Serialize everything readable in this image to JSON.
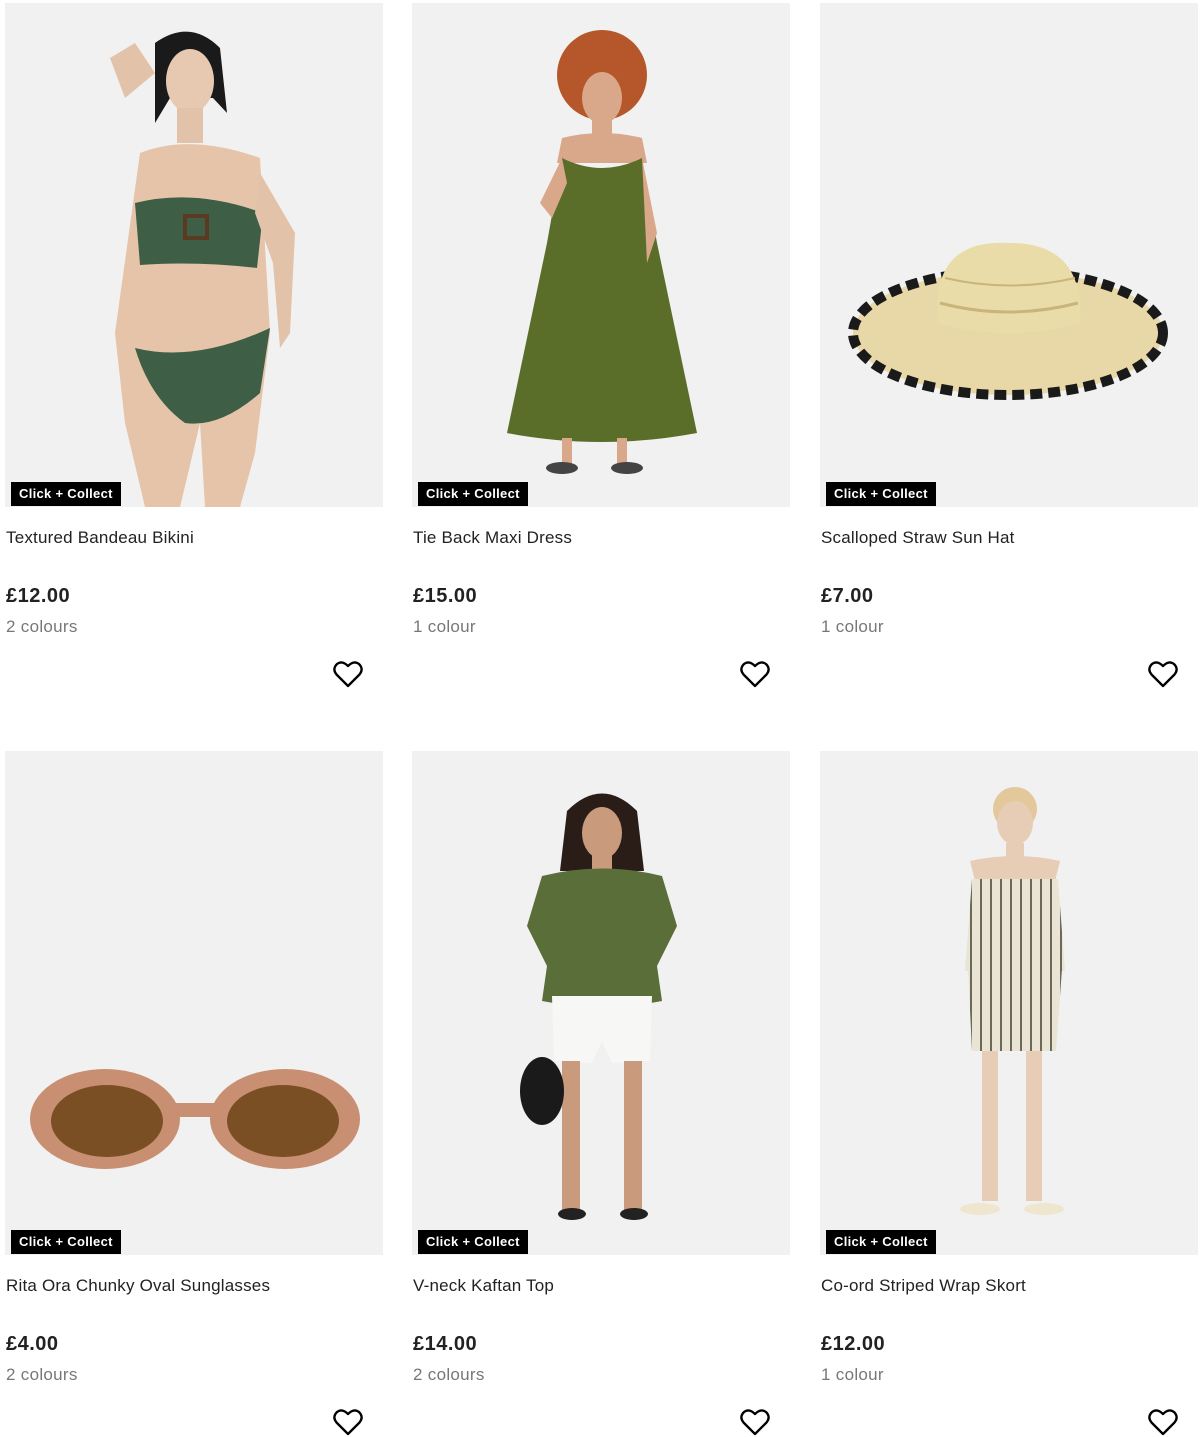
{
  "products": [
    {
      "name": "Textured Bandeau Bikini",
      "price": "£12.00",
      "colours": "2 colours",
      "badge": "Click + Collect",
      "icon": "heart-outline-icon"
    },
    {
      "name": "Tie Back Maxi Dress",
      "price": "£15.00",
      "colours": "1 colour",
      "badge": "Click + Collect",
      "icon": "heart-outline-icon"
    },
    {
      "name": "Scalloped Straw Sun Hat",
      "price": "£7.00",
      "colours": "1 colour",
      "badge": "Click + Collect",
      "icon": "heart-outline-icon"
    },
    {
      "name": "Rita Ora Chunky Oval Sunglasses",
      "price": "£4.00",
      "colours": "2 colours",
      "badge": "Click + Collect",
      "icon": "heart-outline-icon"
    },
    {
      "name": "V-neck Kaftan Top",
      "price": "£14.00",
      "colours": "2 colours",
      "badge": "Click + Collect",
      "icon": "heart-outline-icon"
    },
    {
      "name": "Co-ord Striped Wrap Skort",
      "price": "£12.00",
      "colours": "1 colour",
      "badge": "Click + Collect",
      "icon": "heart-outline-icon"
    }
  ],
  "colors": {
    "badge_bg": "#000000",
    "image_bg": "#f1f1f1",
    "text": "#222222",
    "muted": "#777777"
  }
}
